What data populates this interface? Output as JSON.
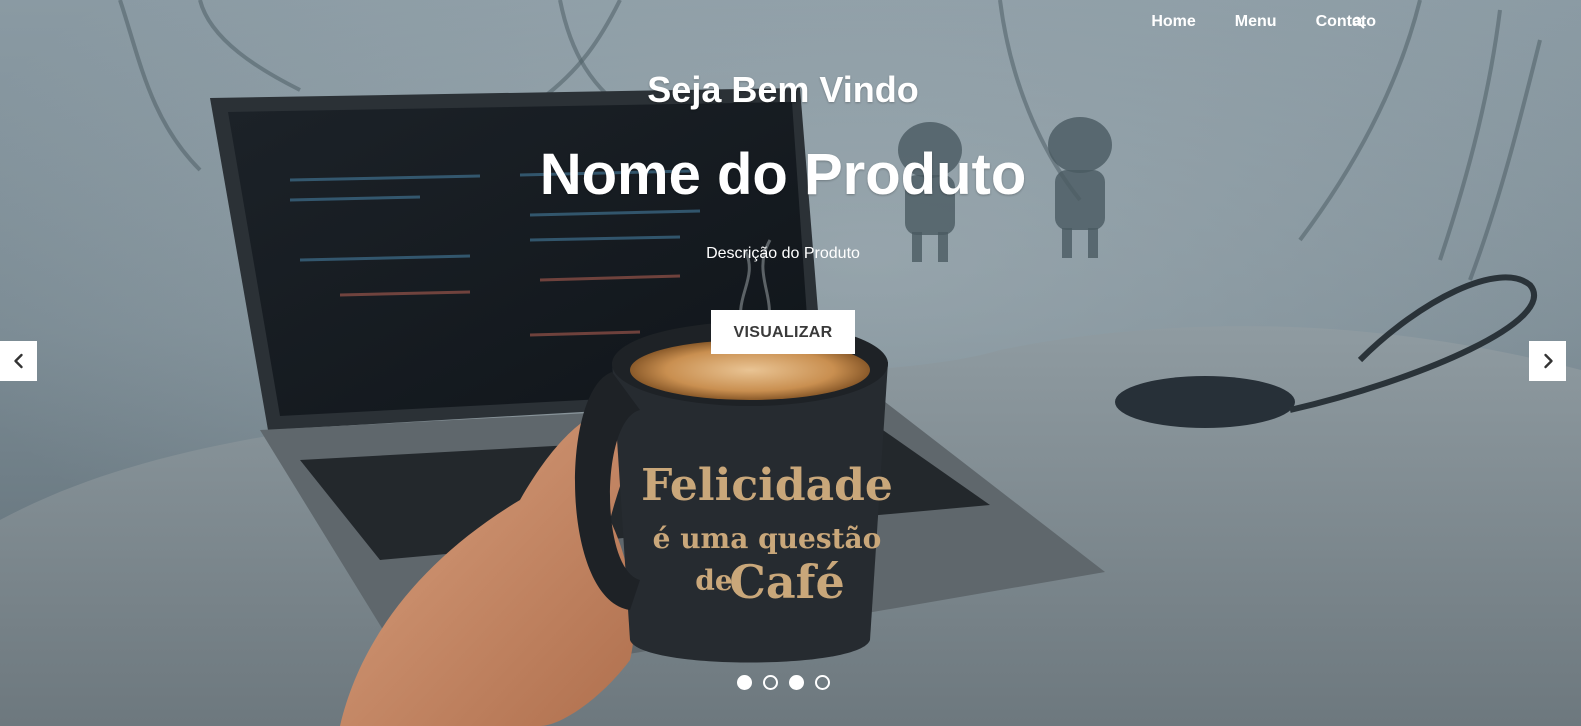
{
  "nav": {
    "items": [
      {
        "label": "Home"
      },
      {
        "label": "Menu"
      },
      {
        "label": "Contato"
      }
    ],
    "search_icon": "search-icon"
  },
  "hero": {
    "welcome": "Seja Bem Vindo",
    "title": "Nome do Produto",
    "description": "Descrição do Produto",
    "button_label": "VISUALIZAR",
    "mug_text": [
      "Felicidade",
      "é uma questão",
      "de",
      "Café"
    ]
  },
  "carousel": {
    "prev_icon": "chevron-left-icon",
    "next_icon": "chevron-right-icon",
    "slide_count": 4,
    "active_slides": [
      0,
      2
    ]
  },
  "colors": {
    "overlay_bg": "#6f7f88",
    "text": "#ffffff",
    "button_bg": "#ffffff",
    "button_text": "#3a3a3a"
  }
}
